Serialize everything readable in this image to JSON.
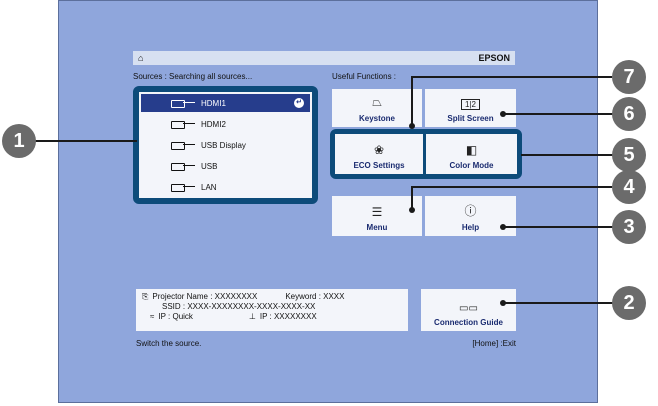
{
  "topbar": {
    "home_icon": "home-icon",
    "brand": "EPSON"
  },
  "sources_label": "Sources : Searching all sources...",
  "useful_functions_label": "Useful Functions :",
  "sources": [
    {
      "label": "HDMI1",
      "icon": "hdmi-port-icon",
      "selected": true
    },
    {
      "label": "HDMI2",
      "icon": "hdmi-port-icon",
      "selected": false
    },
    {
      "label": "USB Display",
      "icon": "usb-port-icon",
      "selected": false
    },
    {
      "label": "USB",
      "icon": "usb-port-icon",
      "selected": false
    },
    {
      "label": "LAN",
      "icon": "lan-icon",
      "selected": false
    }
  ],
  "functions": {
    "keystone": "Keystone",
    "split_screen": "Split Screen",
    "split_icon": "1|2",
    "eco_settings": "ECO Settings",
    "color_mode": "Color Mode",
    "menu": "Menu",
    "help": "Help",
    "connection_guide": "Connection Guide"
  },
  "info": {
    "projector_name_label": "Projector Name : XXXXXXXX",
    "keyword_label": "Keyword : XXXX",
    "ssid_label": "SSID : XXXX-XXXXXXXX-XXXX-XXXX-XX",
    "wireless_ip_label": "IP : Quick",
    "wired_ip_label": "IP : XXXXXXXX"
  },
  "status": {
    "hint": "Switch the source.",
    "exit": "[Home] :Exit"
  },
  "callouts": [
    "1",
    "2",
    "3",
    "4",
    "5",
    "6",
    "7"
  ],
  "colors": {
    "screen_bg": "#8fa6dc",
    "selection": "#263d8c",
    "focus_border": "#0d4b7a",
    "callout": "#6b6b6b"
  }
}
